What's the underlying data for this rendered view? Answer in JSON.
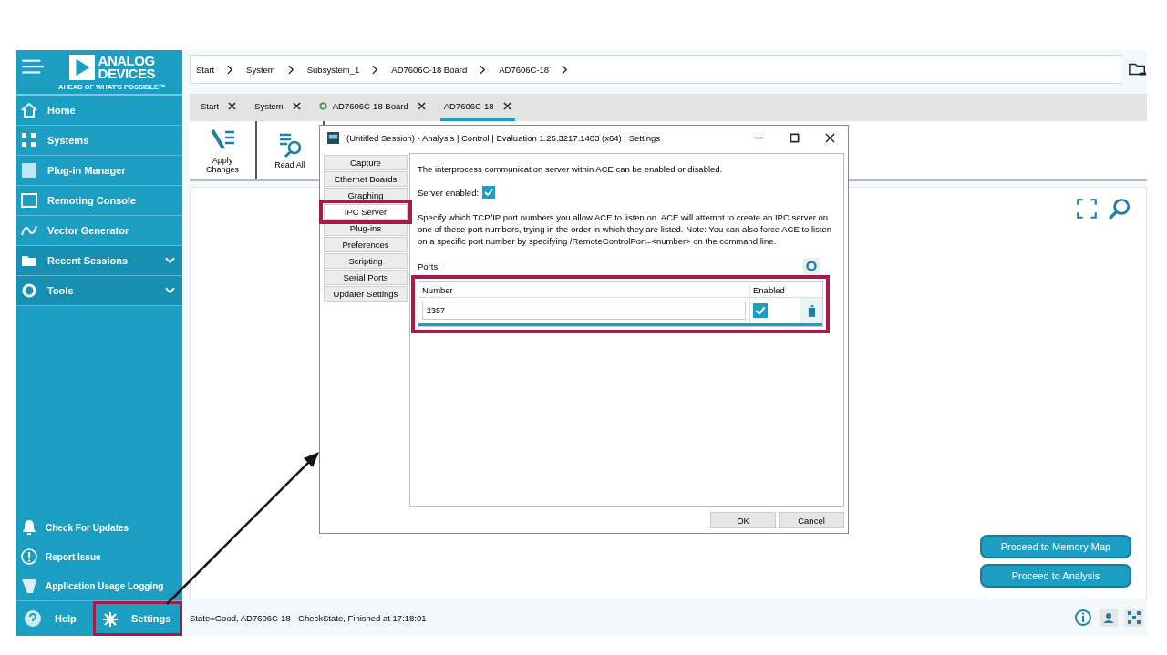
{
  "sidebar": {
    "logo": {
      "line_1": "ANALOG",
      "line_2": "DEVICES",
      "tagline": "AHEAD OF WHAT'S POSSIBLE™"
    },
    "nav": [
      {
        "label": "Home",
        "kind": "item"
      },
      {
        "label": "Systems",
        "kind": "item"
      },
      {
        "label": "Plug-in Manager",
        "kind": "item"
      },
      {
        "label": "Remoting Console",
        "kind": "item"
      },
      {
        "label": "Vector Generator",
        "kind": "item"
      },
      {
        "label": "Recent Sessions",
        "kind": "group",
        "expanded": false
      },
      {
        "label": "Tools",
        "kind": "group",
        "expanded": false
      }
    ],
    "bottom": [
      {
        "label": "Check For Updates"
      },
      {
        "label": "Report Issue"
      },
      {
        "label": "Application Usage Logging"
      }
    ],
    "footer": [
      {
        "label": "Help",
        "highlighted": false
      },
      {
        "label": "Settings",
        "highlighted": true
      }
    ]
  },
  "breadcrumb": [
    "Start",
    "System",
    "Subsystem_1",
    "AD7606C-18 Board",
    "AD7606C-18"
  ],
  "tabs": [
    {
      "label": "Start",
      "selected": false,
      "connected": false
    },
    {
      "label": "System",
      "selected": false,
      "connected": false
    },
    {
      "label": "AD7606C-18 Board",
      "selected": false,
      "connected": true
    },
    {
      "label": "AD7606C-18",
      "selected": true,
      "connected": false
    }
  ],
  "toolbar": [
    {
      "label": "Apply Changes"
    },
    {
      "label": "Read All"
    }
  ],
  "dialog": {
    "title": "(Untitled Session) - Analysis | Control | Evaluation 1.25.3217.1403  (x64) : Settings",
    "categories": [
      {
        "label": "Capture",
        "selected": false,
        "highlighted": false
      },
      {
        "label": "Ethernet Boards",
        "selected": false,
        "highlighted": false
      },
      {
        "label": "Graphing",
        "selected": false,
        "highlighted": false
      },
      {
        "label": "IPC Server",
        "selected": true,
        "highlighted": true
      },
      {
        "label": "Plug-ins",
        "selected": false,
        "highlighted": false
      },
      {
        "label": "Preferences",
        "selected": false,
        "highlighted": false
      },
      {
        "label": "Scripting",
        "selected": false,
        "highlighted": false
      },
      {
        "label": "Serial Ports",
        "selected": false,
        "highlighted": false
      },
      {
        "label": "Updater Settings",
        "selected": false,
        "highlighted": false
      }
    ],
    "intro": "The interprocess communication server within ACE can be enabled or disabled.",
    "server_enabled": {
      "label": "Server enabled:",
      "checked": true
    },
    "description": "Specify which TCP/IP port numbers you allow ACE to listen on.  ACE will attempt to create an IPC server on one of these port numbers, trying in the order in which they are listed. Note: You can also force ACE to listen on a specific port number by specifying /RemoteControlPort=<number> on the command line.",
    "ports_label": "Ports:",
    "ports_table": {
      "highlighted": true,
      "columns": [
        "Number",
        "Enabled"
      ],
      "rows": [
        {
          "number": "2357",
          "enabled": true
        }
      ]
    },
    "buttons": [
      "OK",
      "Cancel"
    ]
  },
  "callout_arrow": true,
  "actions": [
    "Proceed to Memory Map",
    "Proceed to Analysis"
  ],
  "status_bar": {
    "text": "State=Good, AD7606C-18 - CheckState, Finished at 17:18:01"
  }
}
